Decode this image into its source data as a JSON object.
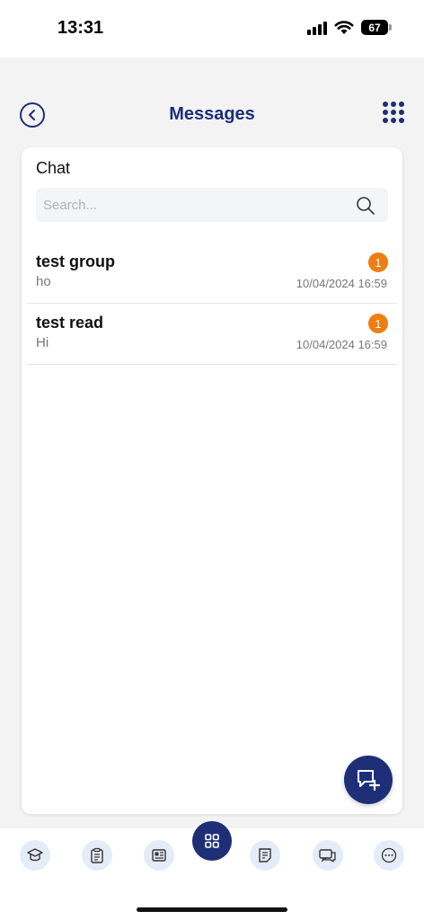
{
  "status_bar": {
    "time": "13:31",
    "battery": "67"
  },
  "header": {
    "title": "Messages",
    "back_icon": "chevron-left-icon",
    "menu_icon": "grid-dots-icon"
  },
  "chat_panel": {
    "title": "Chat",
    "search": {
      "placeholder": "Search...",
      "value": ""
    },
    "items": [
      {
        "name": "test group",
        "preview": "ho",
        "badge": "1",
        "time": "10/04/2024 16:59"
      },
      {
        "name": "test read",
        "preview": "Hi",
        "badge": "1",
        "time": "10/04/2024 16:59"
      }
    ]
  },
  "fab": {
    "icon": "new-chat-icon"
  },
  "bottom_nav": {
    "items": [
      {
        "name": "graduation-cap-icon"
      },
      {
        "name": "clipboard-icon"
      },
      {
        "name": "newspaper-icon"
      },
      {
        "name": "dashboard-grid-icon"
      },
      {
        "name": "note-icon"
      },
      {
        "name": "chat-bubbles-icon"
      },
      {
        "name": "more-icon"
      }
    ]
  },
  "colors": {
    "primary": "#1e2f78",
    "badge": "#ef7d12",
    "background": "#f3f3f3",
    "nav_icon_bg": "#e4ecf7"
  }
}
